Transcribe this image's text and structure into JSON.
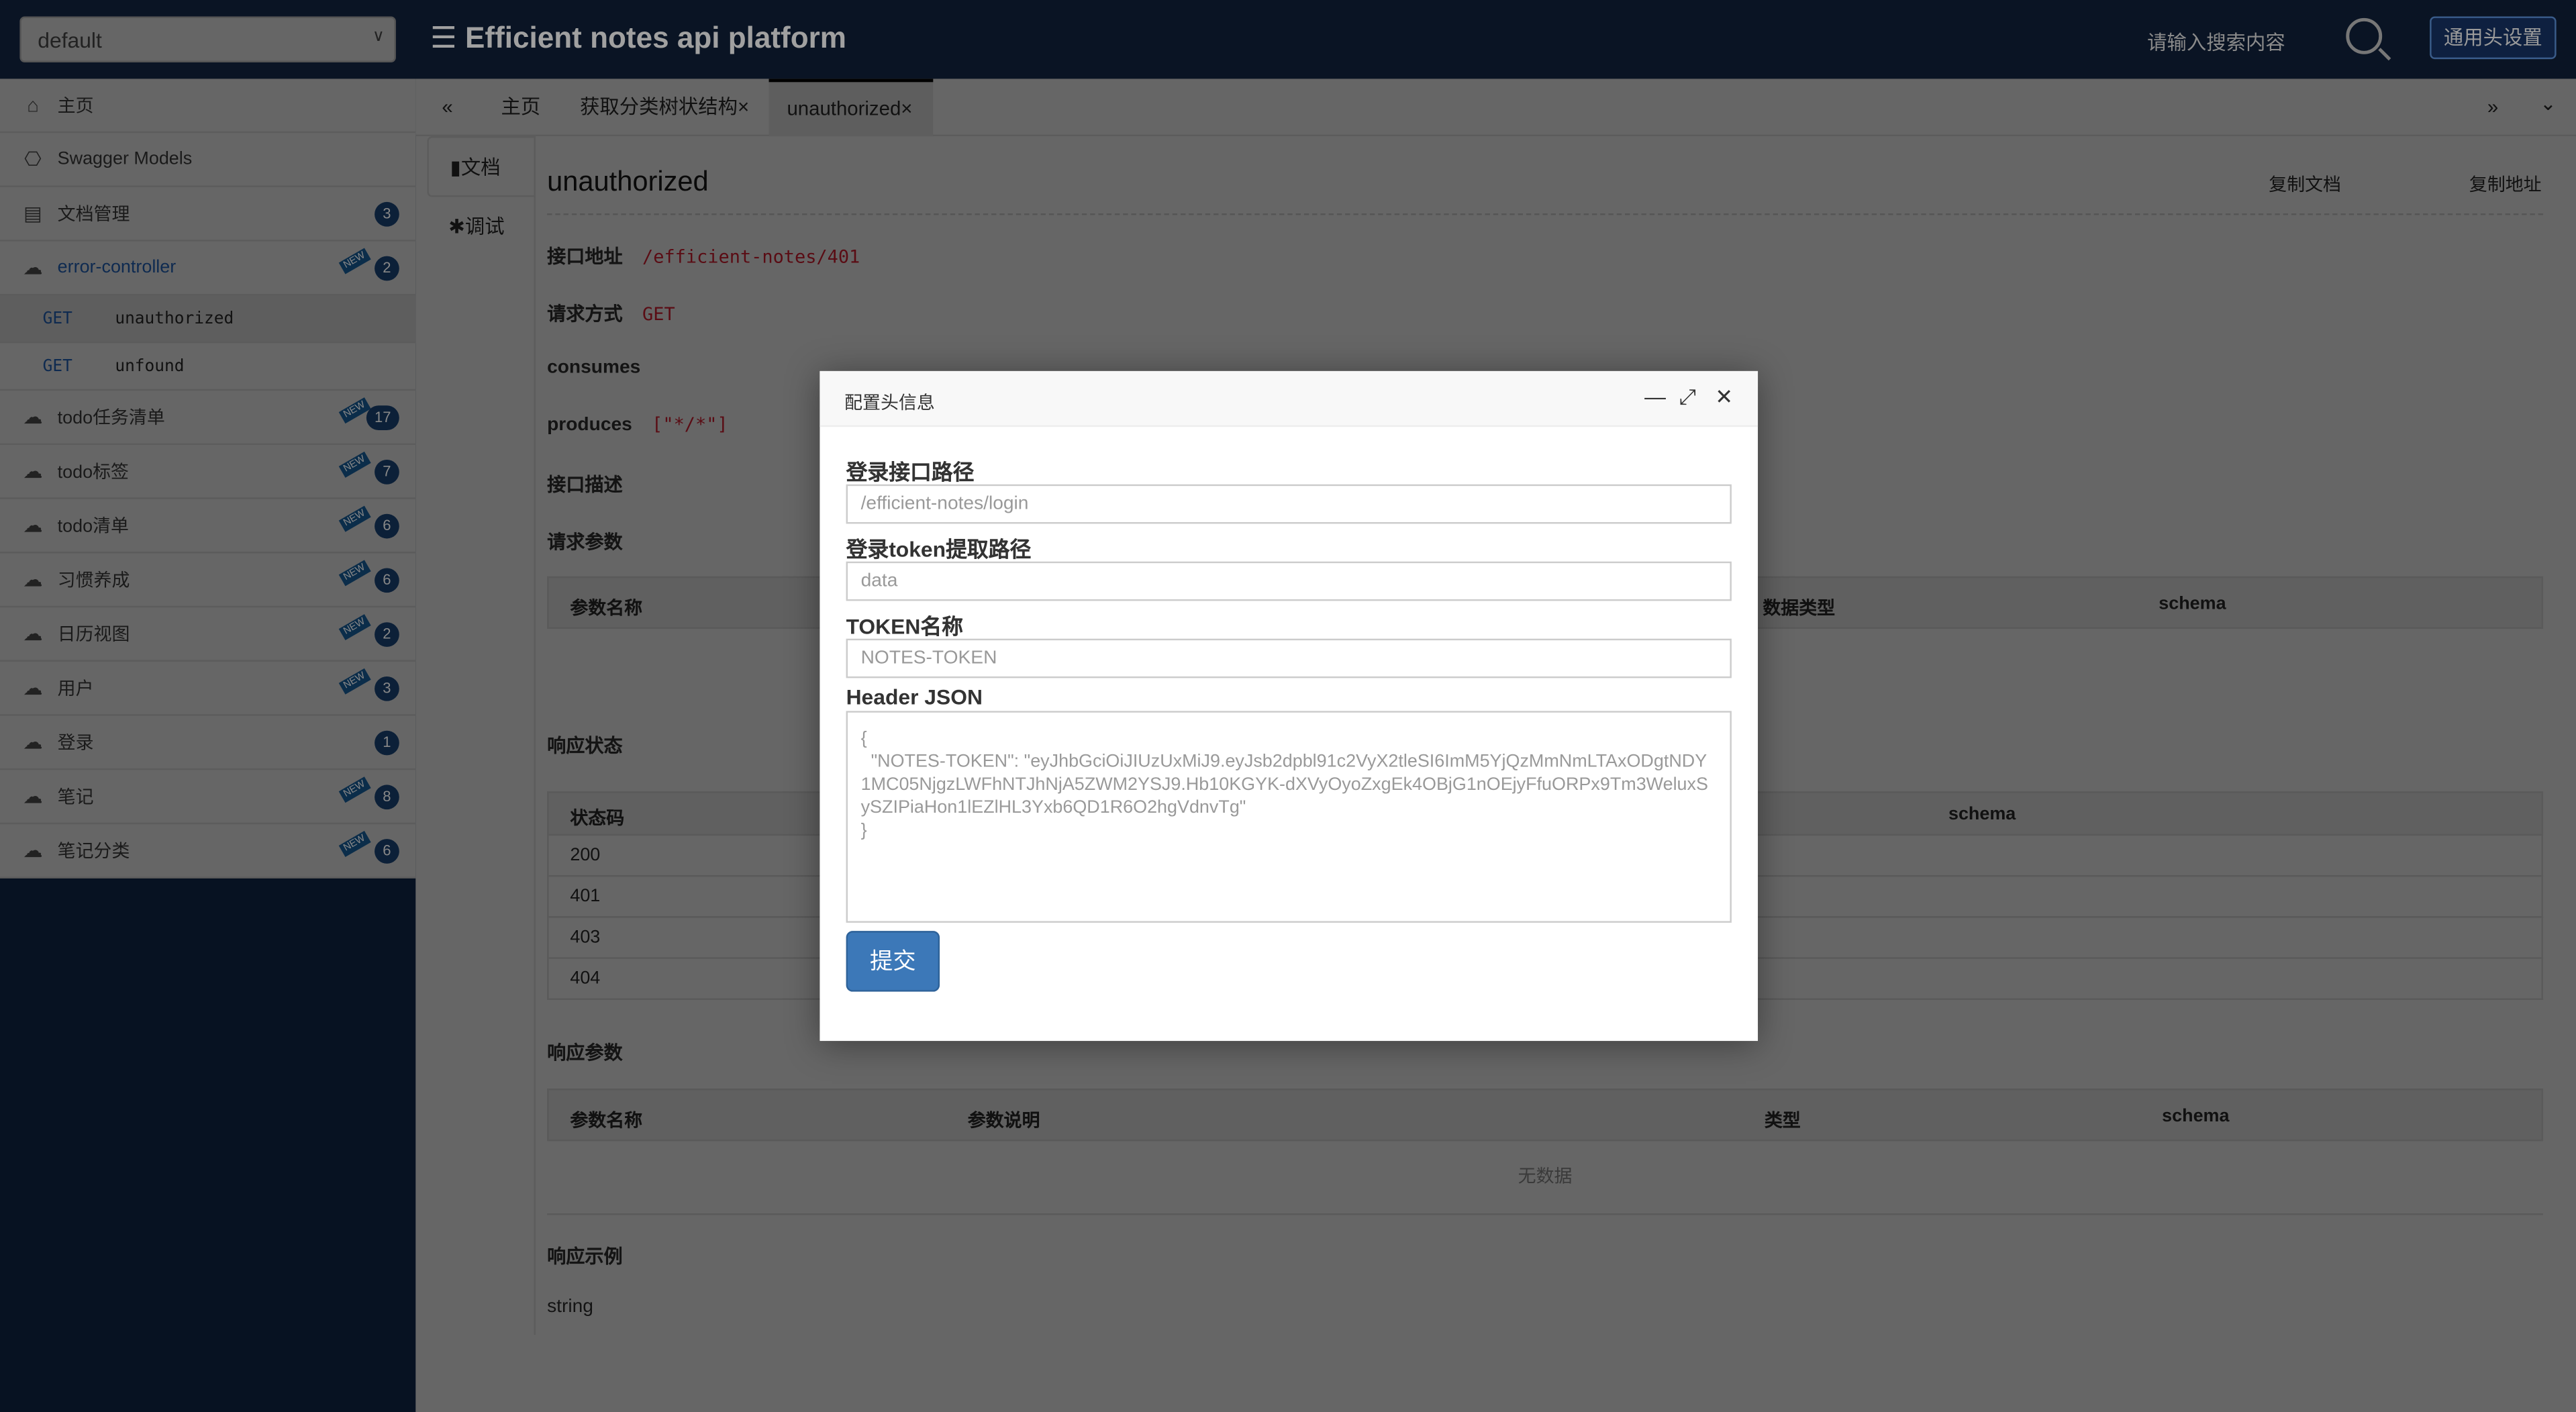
{
  "header": {
    "group": "default",
    "title": "☰ Efficient notes api platform",
    "search_placeholder": "请输入搜索内容",
    "header_settings": "通用头设置"
  },
  "sidebar": {
    "items": [
      {
        "label": "主页",
        "icon": "home-icon"
      },
      {
        "label": "Swagger Models",
        "icon": "models-icon"
      },
      {
        "label": "文档管理",
        "icon": "doc-settings-icon",
        "badge": "3"
      },
      {
        "label": "error-controller",
        "icon": "api-cloud-icon",
        "badge": "2",
        "new": true
      },
      {
        "label": "todo任务清单",
        "badge": "17",
        "new": true
      },
      {
        "label": "todo标签",
        "badge": "7",
        "new": true
      },
      {
        "label": "todo清单",
        "badge": "6",
        "new": true
      },
      {
        "label": "习惯养成",
        "badge": "6",
        "new": true
      },
      {
        "label": "日历视图",
        "badge": "2",
        "new": true
      },
      {
        "label": "用户",
        "badge": "3",
        "new": true
      },
      {
        "label": "登录",
        "badge": "1"
      },
      {
        "label": "笔记",
        "badge": "8",
        "new": true
      },
      {
        "label": "笔记分类",
        "badge": "6",
        "new": true
      }
    ],
    "subitems": [
      {
        "method": "GET",
        "path": "unauthorized"
      },
      {
        "method": "GET",
        "path": "unfound"
      }
    ],
    "new_label": "NEW"
  },
  "tabs": {
    "collapse": "«",
    "items": [
      "主页",
      "获取分类树状结构×",
      "unauthorized×"
    ],
    "more": "»",
    "menu": "⌄"
  },
  "side_tabs": [
    "文档",
    "调试"
  ],
  "doc": {
    "title": "unauthorized",
    "copy_doc": "复制文档",
    "copy_url": "复制地址",
    "url_label": "接口地址",
    "url": "/efficient-notes/401",
    "method_label": "请求方式",
    "method": "GET",
    "consumes_label": "consumes",
    "produces_label": "produces",
    "produces": "[\"*/*\"]",
    "desc_label": "接口描述",
    "params_label": "请求参数",
    "params_headers": [
      "参数名称",
      "数据类型",
      "schema"
    ],
    "status_label": "响应状态",
    "status_headers": [
      "状态码",
      "schema"
    ],
    "status_codes": [
      "200",
      "401",
      "403",
      "404"
    ],
    "resp_params_label": "响应参数",
    "resp_headers": [
      "参数名称",
      "参数说明",
      "类型",
      "schema"
    ],
    "no_data": "无数据",
    "example_label": "响应示例",
    "example": "string"
  },
  "modal": {
    "title": "配置头信息",
    "login_path_label": "登录接口路径",
    "login_path_placeholder": "/efficient-notes/login",
    "token_path_label": "登录token提取路径",
    "token_path_placeholder": "data",
    "token_name_label": "TOKEN名称",
    "token_name_placeholder": "NOTES-TOKEN",
    "header_json_label": "Header JSON",
    "header_json": "{\n  \"NOTES-TOKEN\": \"eyJhbGciOiJIUzUxMiJ9.eyJsb2dpbl91c2VyX2tleSI6ImM5YjQzMmNmLTAxODgtNDY1MC05NjgzLWFhNTJhNjA5ZWM2YSJ9.Hb10KGYK-dXVyOyoZxgEk4OBjG1nOEjyFfuORPx9Tm3WeluxSySZIPiaHon1lEZlHL3Yxb6QD1R6O2hgVdnvTg\"\n}",
    "submit": "提交"
  }
}
